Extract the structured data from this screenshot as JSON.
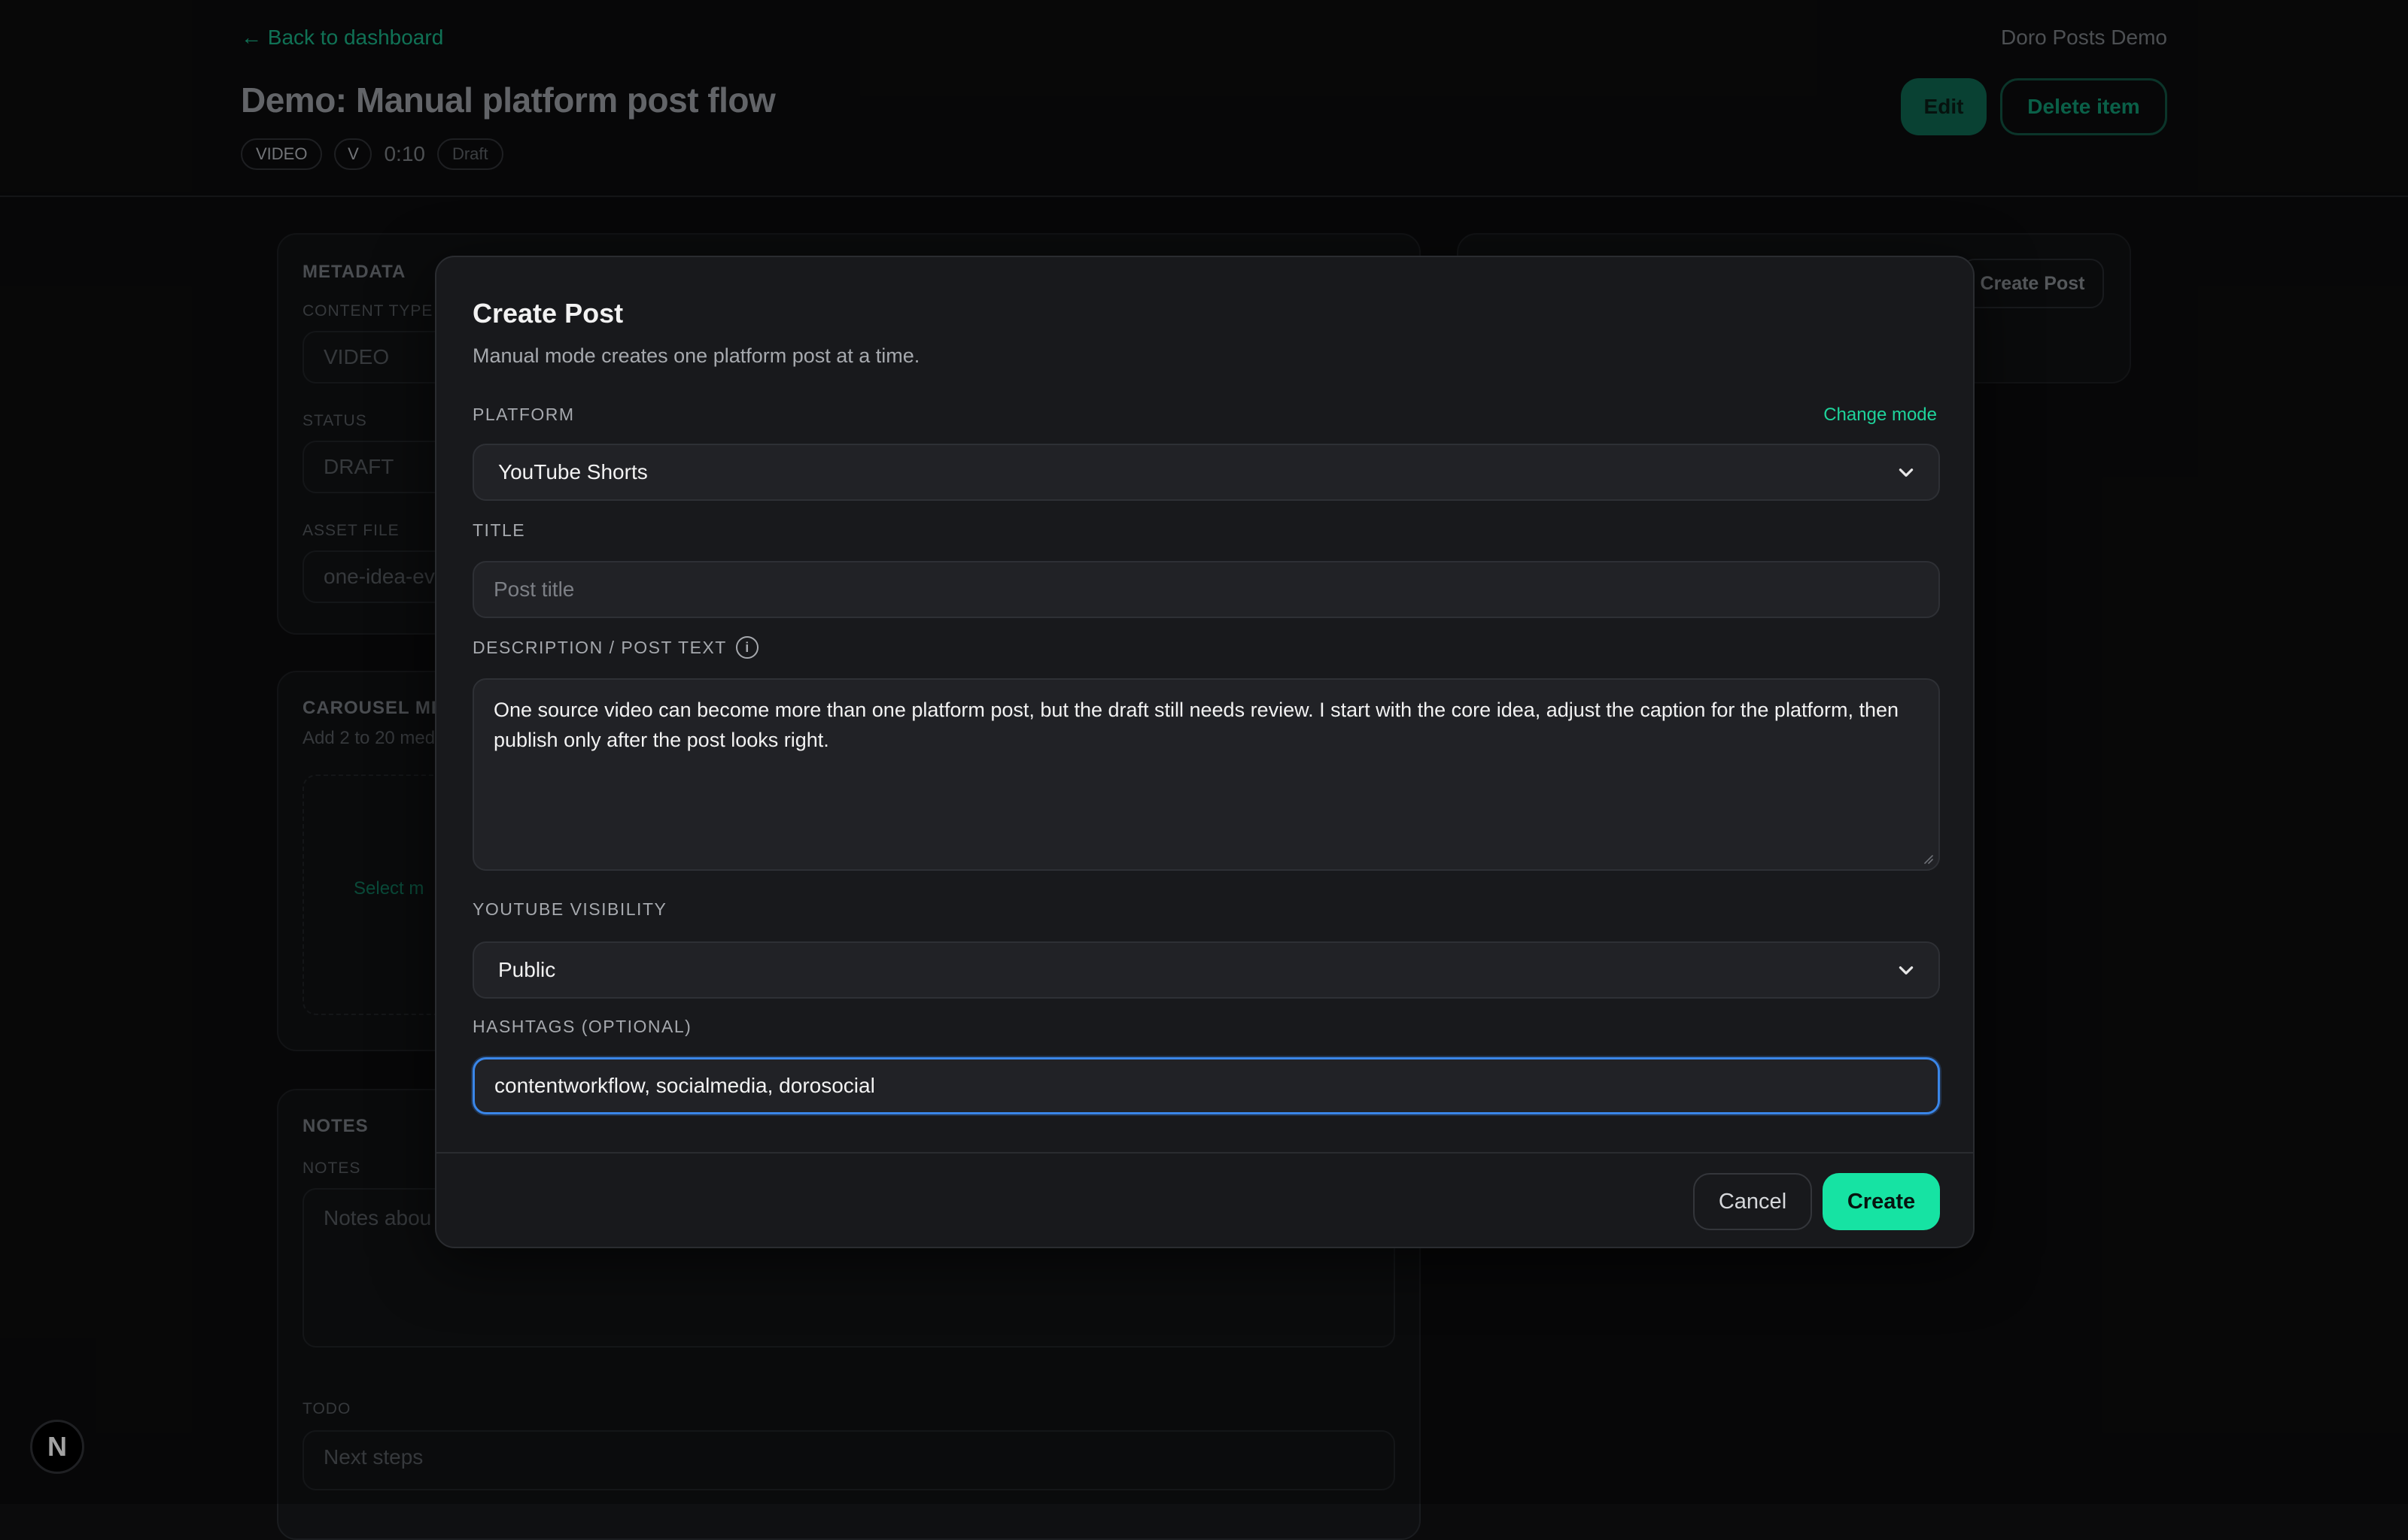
{
  "header": {
    "back_link": "← Back to dashboard",
    "workspace": "Doro Posts Demo",
    "title": "Demo: Manual platform post flow",
    "type_pill": "VIDEO",
    "platform_pill": "V",
    "duration": "0:10",
    "status_pill": "Draft",
    "edit_label": "Edit",
    "delete_label": "Delete item"
  },
  "metadata_card": {
    "title": "METADATA",
    "content_type_label": "CONTENT TYPE",
    "content_type_value": "VIDEO",
    "status_label": "STATUS",
    "status_value": "DRAFT",
    "asset_label": "ASSET FILE",
    "asset_value": "one-idea-ev"
  },
  "carousel_card": {
    "title": "CAROUSEL ME",
    "subtitle": "Add 2 to 20 med",
    "dropzone_link": "Select m"
  },
  "notes_card": {
    "title": "NOTES",
    "notes_label": "NOTES",
    "notes_placeholder": "Notes abou",
    "todo_label": "TODO",
    "todo_placeholder": "Next steps"
  },
  "posts_card": {
    "create_post_label": "Create Post"
  },
  "next_badge": "N",
  "modal": {
    "title": "Create Post",
    "subtitle": "Manual mode creates one platform post at a time.",
    "platform_label": "PLATFORM",
    "change_mode": "Change mode",
    "platform_value": "YouTube Shorts",
    "title_label": "TITLE",
    "title_placeholder": "Post title",
    "description_label": "DESCRIPTION / POST TEXT",
    "description_value": "One source video can become more than one platform post, but the draft still needs review. I start with the core idea, adjust the caption for the platform, then publish only after the post looks right.",
    "visibility_label": "YOUTUBE VISIBILITY",
    "visibility_value": "Public",
    "hashtags_label": "HASHTAGS (OPTIONAL)",
    "hashtags_value": "contentworkflow, socialmedia, dorosocial",
    "cancel_label": "Cancel",
    "create_label": "Create"
  },
  "colors": {
    "accent": "#16e3a3",
    "focus_ring": "#3a86e8",
    "modal_bg": "#18191c",
    "page_bg": "#0b0b0c"
  }
}
